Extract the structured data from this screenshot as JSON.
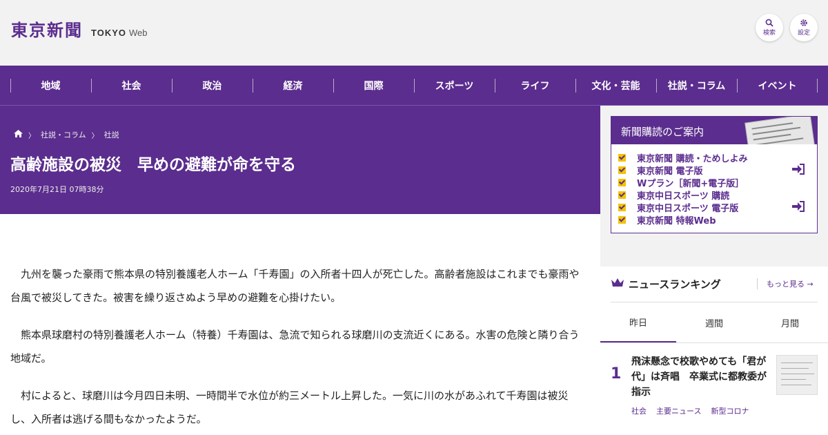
{
  "header": {
    "logo_kanji": "東京新聞",
    "logo_tokyo": "TOKYO",
    "logo_web": "Web",
    "search_label": "検索",
    "settings_label": "設定"
  },
  "nav": {
    "items": [
      "地域",
      "社会",
      "政治",
      "経済",
      "国際",
      "スポーツ",
      "ライフ",
      "文化・芸能",
      "社説・コラム",
      "イベント"
    ]
  },
  "article": {
    "breadcrumb": [
      "社説・コラム",
      "社説"
    ],
    "title": "高齢施設の被災　早めの避難が命を守る",
    "date": "2020年7月21日 07時38分",
    "paragraphs": [
      "九州を襲った豪雨で熊本県の特別養護老人ホーム「千寿園」の入所者十四人が死亡した。高齢者施設はこれまでも豪雨や台風で被災してきた。被害を繰り返さぬよう早めの避難を心掛けたい。",
      "熊本県球磨村の特別養護老人ホーム（特養）千寿園は、急流で知られる球磨川の支流近くにある。水害の危険と隣り合う地域だ。",
      "村によると、球磨川は今月四日未明、一時間半で水位が約三メートル上昇した。一気に川の水があふれて千寿園は被災し、入所者は逃げる間もなかったようだ。"
    ]
  },
  "subscription": {
    "title": "新聞購読のご案内",
    "items": [
      "東京新聞 購読・ためしよみ",
      "東京新聞 電子版",
      "Wプラン［新聞+電子版］",
      "東京中日スポーツ 購読",
      "東京中日スポーツ 電子版",
      "東京新聞 特報Web"
    ]
  },
  "ranking": {
    "title": "ニュースランキング",
    "more": "もっと見る",
    "tabs": [
      "昨日",
      "週間",
      "月間"
    ],
    "top_item": {
      "rank": "1",
      "title": "飛沫懸念で校歌やめても「君が代」は斉唱　卒業式に都教委が指示",
      "tags": [
        "社会",
        "主要ニュース",
        "新型コロナ"
      ]
    }
  },
  "colors": {
    "brand": "#5b2d8e",
    "check": "#f4c300"
  }
}
